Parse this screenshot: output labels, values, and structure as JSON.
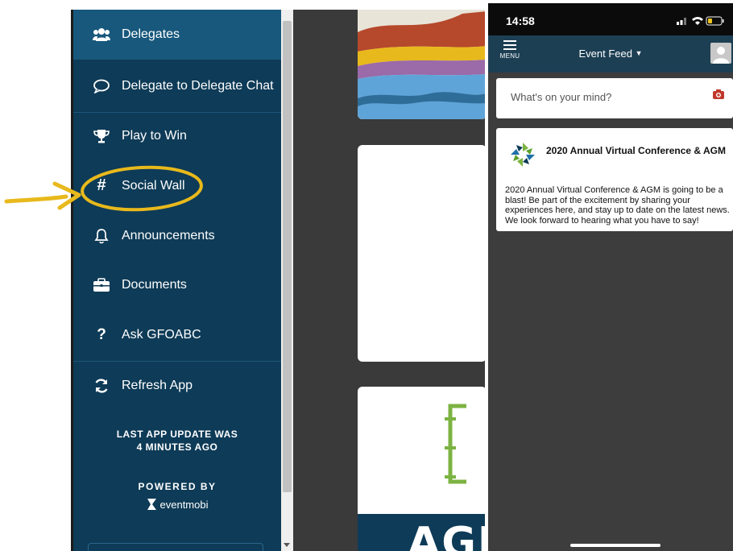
{
  "sidebar": {
    "items": [
      {
        "label": "Delegates",
        "icon": "users-icon"
      },
      {
        "label": "Delegate to Delegate Chat",
        "icon": "chat-bubble-icon"
      },
      {
        "label": "Play to Win",
        "icon": "trophy-icon"
      },
      {
        "label": "Social Wall",
        "icon": "hashtag-icon"
      },
      {
        "label": "Announcements",
        "icon": "bell-icon"
      },
      {
        "label": "Documents",
        "icon": "briefcase-icon"
      },
      {
        "label": "Ask GFOABC",
        "icon": "question-icon"
      },
      {
        "label": "Refresh App",
        "icon": "refresh-icon"
      }
    ],
    "last_update_line1": "LAST APP UPDATE WAS",
    "last_update_line2": "4 MINUTES AGO",
    "powered_by": "POWERED BY",
    "brand": "eventmobi"
  },
  "preview": {
    "big_text": "AGE"
  },
  "phone": {
    "time": "14:58",
    "menu_label": "MENU",
    "nav_title": "Event Feed",
    "post_placeholder": "What's on your mind?",
    "feed_card": {
      "title": "2020 Annual Virtual Conference & AGM",
      "body": "2020 Annual Virtual Conference & AGM is going to be a blast! Be part of the excitement by sharing your experiences here, and stay up to date on the latest news. We look forward to hearing what you have to say!"
    }
  },
  "colors": {
    "sidebar_bg": "#0e3b57",
    "sidebar_active": "#17587c",
    "navbar_bg": "#1d3f53",
    "annotation_yellow": "#e8b91c",
    "camera_red": "#c0392b"
  }
}
